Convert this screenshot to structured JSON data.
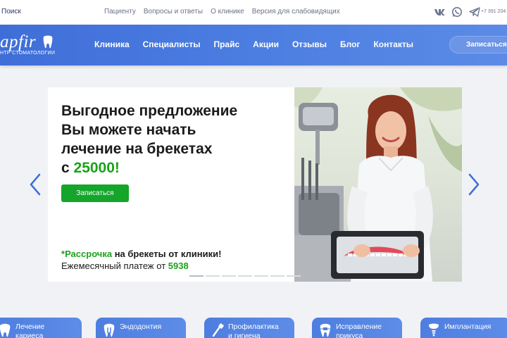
{
  "topbar": {
    "search_label": "Поиск",
    "links": [
      "Пациенту",
      "Вопросы и ответы",
      "О клинике",
      "Версия для слабовидящих"
    ],
    "socials": [
      "vk-icon",
      "whatsapp-icon",
      "telegram-icon"
    ],
    "phone": "+7 391 204"
  },
  "nav": {
    "logo_word": "apfir",
    "logo_sub": "НТР СТОМАТОЛОГИИ",
    "items": [
      "Клиника",
      "Специалисты",
      "Прайс",
      "Акции",
      "Отзывы",
      "Блог",
      "Контакты"
    ],
    "cta_label": "Записаться"
  },
  "banner": {
    "line1": "Выгодное предложение",
    "line2": "Вы можете начать",
    "line3": "лечение на брекетах",
    "line4_prefix": "с ",
    "line4_price": "25000!",
    "button_label": "Записаться",
    "note_star": "*",
    "note_green": "Рассрочка",
    "note_rest": " на брекеты от клиники!",
    "note_line2": "Ежемесячный платеж от ",
    "note_amount": "5938",
    "slides_count": 7,
    "active_slide": 1
  },
  "services": [
    {
      "line1": "Лечение",
      "line2": "кариеса",
      "icon": "tooth-icon"
    },
    {
      "line1": "Эндодонтия",
      "line2": "",
      "icon": "tooth-root-icon"
    },
    {
      "line1": "Профилактика",
      "line2": "и гигиена",
      "icon": "toothbrush-icon"
    },
    {
      "line1": "Исправление",
      "line2": "прикуса",
      "icon": "braces-icon"
    },
    {
      "line1": "Имплантация",
      "line2": "",
      "icon": "implant-icon"
    }
  ],
  "colors": {
    "nav_blue": "#4a79de",
    "accent_green": "#14a52a",
    "arrow_blue": "#3d6fd8"
  }
}
